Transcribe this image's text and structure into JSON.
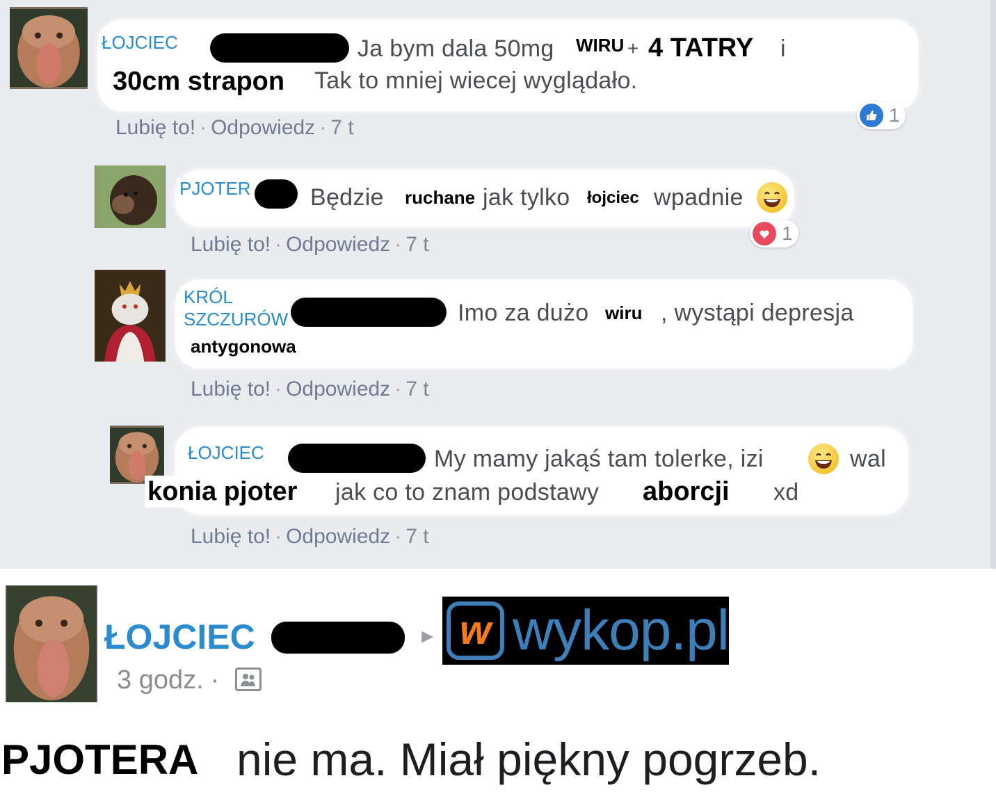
{
  "comments": [
    {
      "name": "ŁOJCIEC",
      "text_1": "Ja bym dala 50mg",
      "bold_1": "WIRU",
      "plus": "+",
      "bold_2": "4 TATRY",
      "text_2": "i",
      "bold_3": "30cm strapon",
      "text_3": "Tak to mniej wiecej wyglądało.",
      "like": "Lubię to!",
      "sep": "·",
      "reply": "Odpowiedz",
      "time": "7 t",
      "reaction_icon": "like-icon",
      "reaction_count": "1"
    },
    {
      "name": "PJOTER",
      "text_1": "Będzie",
      "bold_1": "ruchane",
      "text_2": "jak tylko",
      "bold_2": "łojciec",
      "text_3": "wpadnie",
      "like": "Lubię to!",
      "sep": "·",
      "reply": "Odpowiedz",
      "time": "7 t",
      "reaction_icon": "heart-icon",
      "reaction_count": "1"
    },
    {
      "name_1": "KRÓL",
      "name_2": "SZCZURÓW",
      "text_1": "Imo za dużo",
      "bold_1": "wiru",
      "text_2": ", wystąpi depresja",
      "bold_2": "antygonowa",
      "like": "Lubię to!",
      "sep": "·",
      "reply": "Odpowiedz",
      "time": "7 t"
    },
    {
      "name": "ŁOJCIEC",
      "text_1": "My mamy jakąś tam tolerke, izi",
      "text_2": "wal",
      "bold_1": "konia pjoter",
      "text_3": "jak co to znam podstawy",
      "bold_2": "aborcji",
      "text_4": "xd",
      "like": "Lubię to!",
      "sep": "·",
      "reply": "Odpowiedz",
      "time": "7 t"
    }
  ],
  "post": {
    "author": "ŁOJCIEC",
    "arrow": "▸",
    "target": "wykop.pl",
    "time": "3 godz.",
    "sep": "·",
    "audience_icon": "friends-icon",
    "bold": "PJOTERA",
    "text": "nie ma. Miał piękny pogrzeb."
  },
  "colors": {
    "thread_bg": "#e9ebee",
    "name_blue": "#2a8ccf",
    "action_gray": "#7d8593",
    "wykop_blue": "#3d7fb8",
    "wykop_orange": "#f47a20"
  }
}
